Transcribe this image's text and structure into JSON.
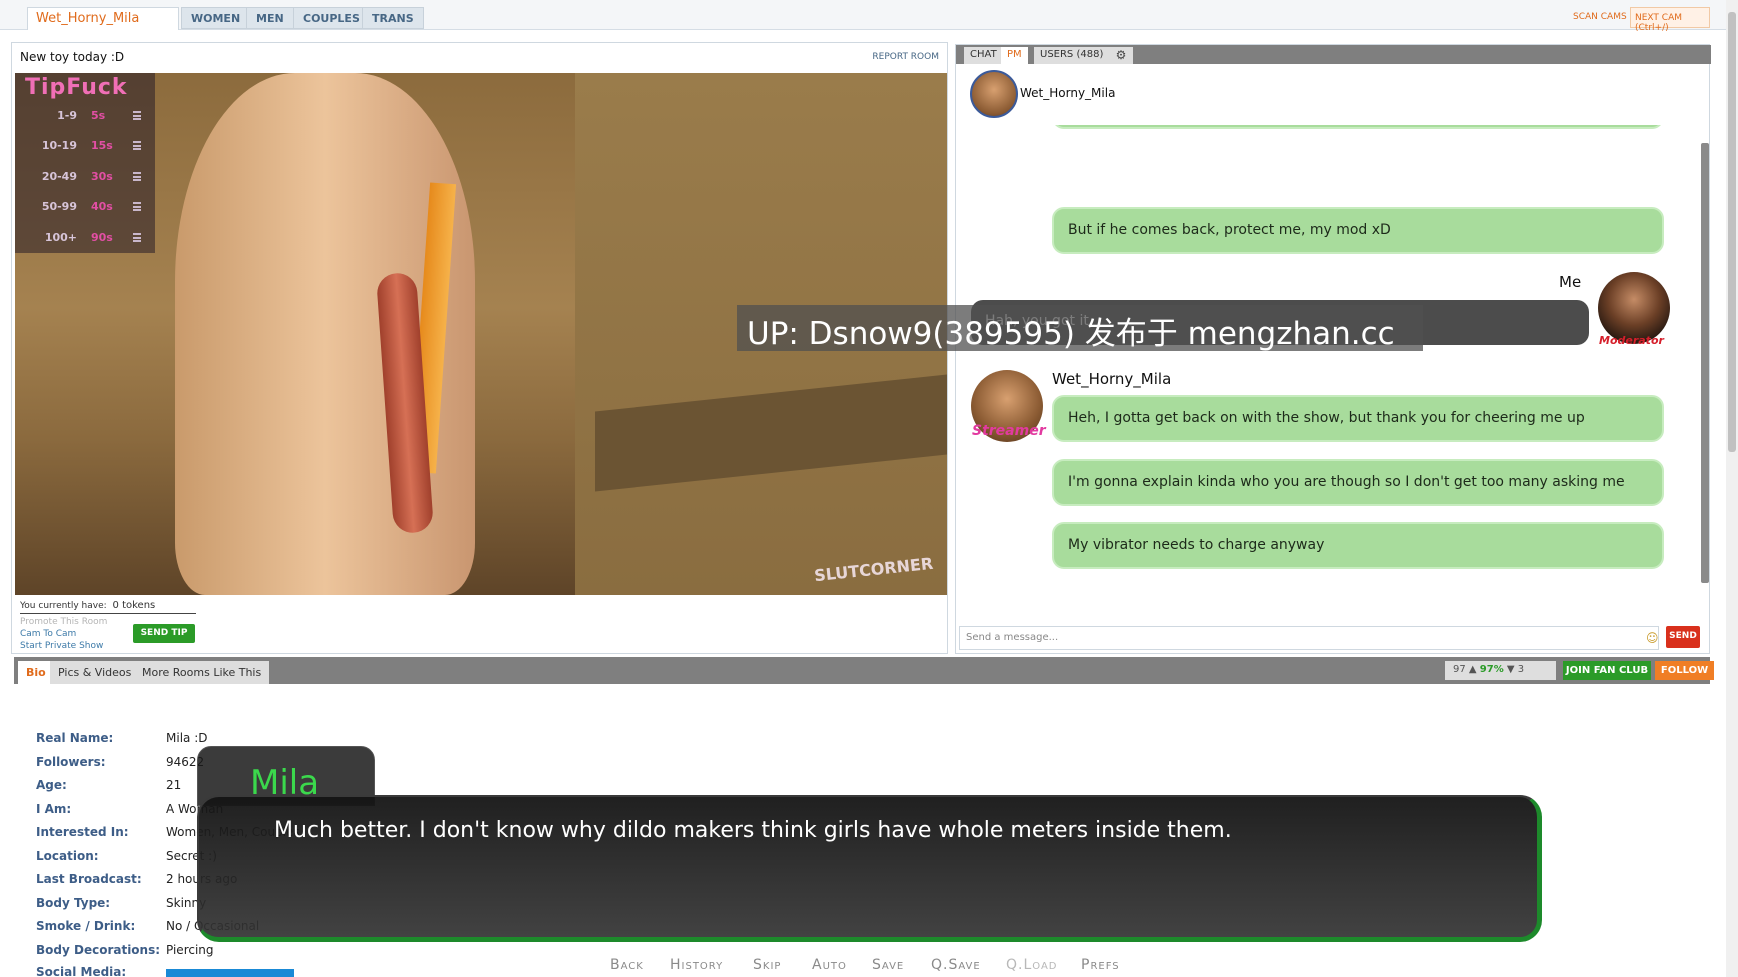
{
  "topnav": {
    "room_tab": "Wet_Horny_Mila",
    "categories": [
      "WOMEN",
      "MEN",
      "COUPLES",
      "TRANS"
    ],
    "scan_cams": "SCAN CAMS",
    "next_cam": "NEXT CAM (Ctrl+/)"
  },
  "video_panel": {
    "subject": "New toy today :D",
    "report_room": "REPORT ROOM",
    "tip_menu": {
      "title": "TipFuck",
      "rows": [
        {
          "range": "1-9",
          "time": "5s"
        },
        {
          "range": "10-19",
          "time": "15s"
        },
        {
          "range": "20-49",
          "time": "30s"
        },
        {
          "range": "50-99",
          "time": "40s"
        },
        {
          "range": "100+",
          "time": "90s"
        }
      ]
    },
    "video_watermark": "SLUTCORNER",
    "tokens_label": "You currently have:",
    "tokens_value": "0 tokens",
    "promote": "Promote This Room",
    "cam_to_cam": "Cam To Cam",
    "private_show": "Start Private Show",
    "send_tip": "SEND TIP"
  },
  "chat_panel": {
    "tabs": {
      "chat": "CHAT",
      "pm": "PM",
      "users": "USERS (488)"
    },
    "pm_user": "Wet_Horny_Mila",
    "messages": [
      {
        "text": "But if he comes back, protect me, my mod xD"
      },
      {
        "sender": "Me",
        "badge": "Moderator",
        "text": "Hah, you got it."
      },
      {
        "sender": "Wet_Horny_Mila",
        "badge": "Streamer",
        "text": "Heh, I gotta get back on with the show, but thank you for cheering me up"
      },
      {
        "text": "I'm gonna explain kinda who you are though so I don't get too many asking me"
      },
      {
        "text": "My vibrator needs to charge anyway"
      }
    ],
    "input_placeholder": "Send a message...",
    "send": "SEND"
  },
  "bio_bar": {
    "tabs": [
      "Bio",
      "Pics & Videos",
      "More Rooms Like This"
    ],
    "likes": "97",
    "percent": "97%",
    "dislikes": "3",
    "join_fan_club": "JOIN FAN CLUB",
    "follow": "FOLLOW"
  },
  "bio": [
    {
      "label": "Real Name:",
      "value": "Mila :D"
    },
    {
      "label": "Followers:",
      "value": "94622"
    },
    {
      "label": "Age:",
      "value": "21"
    },
    {
      "label": "I Am:",
      "value": "A Woman"
    },
    {
      "label": "Interested In:",
      "value": "Women, Men, Couples"
    },
    {
      "label": "Location:",
      "value": "Secret :)"
    },
    {
      "label": "Last Broadcast:",
      "value": "2 hours ago"
    },
    {
      "label": "Body Type:",
      "value": "Skinny"
    },
    {
      "label": "Smoke / Drink:",
      "value": "No / Occasional"
    },
    {
      "label": "Body Decorations:",
      "value": "Piercing"
    },
    {
      "label": "Social Media:",
      "value": ""
    }
  ],
  "dialogue": {
    "speaker": "Mila",
    "text": "Much better. I don't know why dildo makers think girls have whole meters inside them."
  },
  "quick_menu": [
    "Back",
    "History",
    "Skip",
    "Auto",
    "Save",
    "Q.Save",
    "Q.Load",
    "Prefs"
  ],
  "overlay_watermark": "UP: Dsnow9(389595) 发布于 mengzhan.cc",
  "colors": {
    "accent_orange": "#e06b1c",
    "chat_green": "#a8dc9c",
    "dialogue_green": "#3bd84c",
    "send_red": "#d9301c",
    "fan_green": "#2b9b28"
  }
}
